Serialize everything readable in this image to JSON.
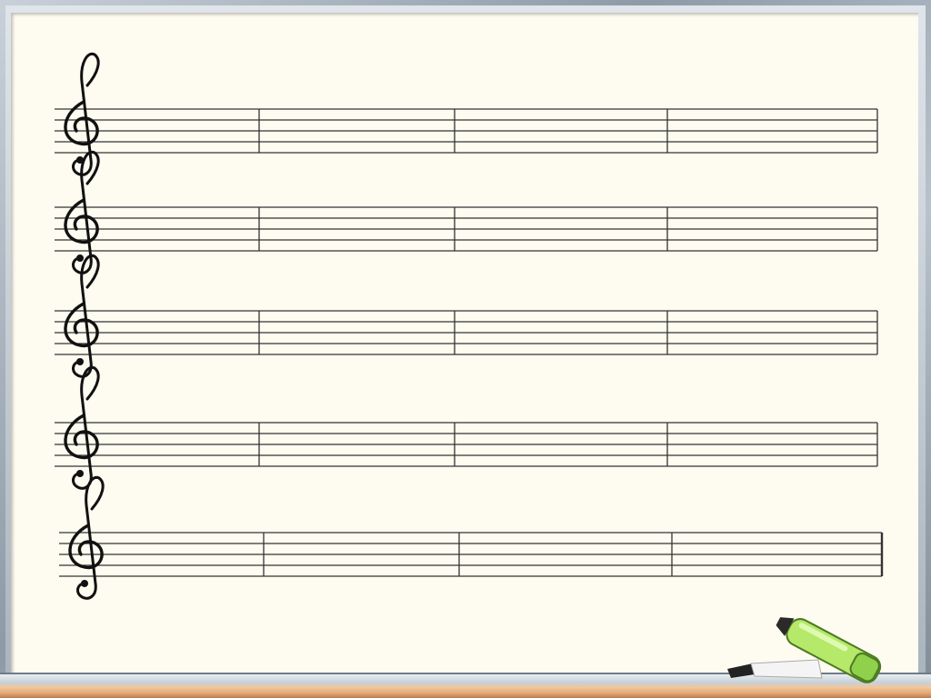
{
  "board": {
    "background_color": "#fefbf0",
    "frame_color": "#9aa6b4"
  },
  "staff_system": {
    "clef": "treble-clef",
    "staff_count": 5,
    "measures_per_staff": 4,
    "lines_per_staff": 5,
    "line_color": "#333333"
  },
  "decorations": {
    "marker_icon": "green-highlighter-marker-icon",
    "marker_color": "#b6e86a"
  }
}
